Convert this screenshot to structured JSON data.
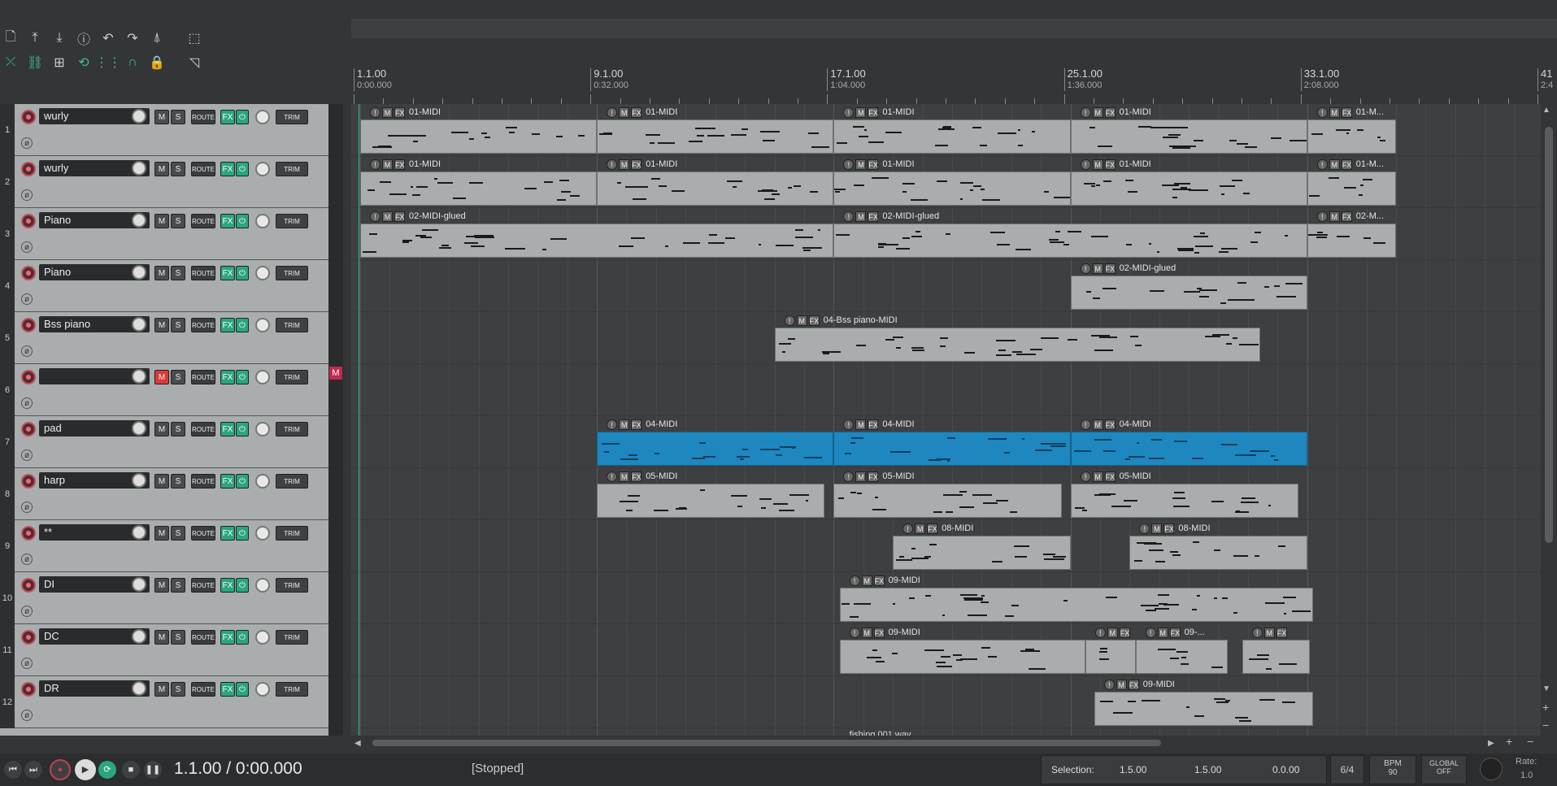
{
  "toolbar": {
    "row1": [
      "new-project-icon",
      "open-project-icon",
      "save-project-icon",
      "info-icon",
      "undo-icon",
      "redo-icon",
      "metronome-icon",
      "grid-toggle-icon"
    ],
    "row2": [
      "ripple-icon",
      "link-icon",
      "grid-snap-icon",
      "loop-link-icon",
      "snap-grid-icon",
      "magnet-icon",
      "lock-icon",
      "envelope-tool-icon"
    ]
  },
  "ruler": [
    {
      "bar": "1.1.00",
      "time": "0:00.000"
    },
    {
      "bar": "9.1.00",
      "time": "0:32.000"
    },
    {
      "bar": "17.1.00",
      "time": "1:04.000"
    },
    {
      "bar": "25.1.00",
      "time": "1:36.000"
    },
    {
      "bar": "33.1.00",
      "time": "2:08.000"
    },
    {
      "bar": "41",
      "time": "2:4"
    }
  ],
  "tcp": {
    "mute_label": "M",
    "solo_label": "S",
    "route_label": "ROUTE",
    "fx_label": "FX",
    "power_label": "⏻",
    "trim_label": "TRIM",
    "phase_label": "ø"
  },
  "tracks": [
    {
      "num": "1",
      "name": "wurly",
      "muted": false
    },
    {
      "num": "2",
      "name": "wurly",
      "muted": false
    },
    {
      "num": "3",
      "name": "Piano",
      "muted": false
    },
    {
      "num": "4",
      "name": "Piano",
      "muted": false
    },
    {
      "num": "5",
      "name": "Bss piano",
      "muted": false
    },
    {
      "num": "6",
      "name": "",
      "muted": true
    },
    {
      "num": "7",
      "name": "pad",
      "muted": false
    },
    {
      "num": "8",
      "name": "harp",
      "muted": false
    },
    {
      "num": "9",
      "name": "**",
      "muted": false
    },
    {
      "num": "10",
      "name": "DI",
      "muted": false
    },
    {
      "num": "11",
      "name": "DC",
      "muted": false
    },
    {
      "num": "12",
      "name": "DR",
      "muted": false
    }
  ],
  "meter_mute_label": "M",
  "items": [
    {
      "track": 0,
      "start": 0,
      "end": 8,
      "label": "01-MIDI"
    },
    {
      "track": 0,
      "start": 8,
      "end": 16,
      "label": "01-MIDI"
    },
    {
      "track": 0,
      "start": 16,
      "end": 24,
      "label": "01-MIDI"
    },
    {
      "track": 0,
      "start": 24,
      "end": 32,
      "label": "01-MIDI"
    },
    {
      "track": 0,
      "start": 32,
      "end": 35,
      "label": "01-M..."
    },
    {
      "track": 1,
      "start": 0,
      "end": 8,
      "label": "01-MIDI"
    },
    {
      "track": 1,
      "start": 8,
      "end": 16,
      "label": "01-MIDI"
    },
    {
      "track": 1,
      "start": 16,
      "end": 24,
      "label": "01-MIDI"
    },
    {
      "track": 1,
      "start": 24,
      "end": 32,
      "label": "01-MIDI"
    },
    {
      "track": 1,
      "start": 32,
      "end": 35,
      "label": "01-M..."
    },
    {
      "track": 2,
      "start": 0,
      "end": 16,
      "label": "02-MIDI-glued"
    },
    {
      "track": 2,
      "start": 16,
      "end": 32,
      "label": "02-MIDI-glued"
    },
    {
      "track": 2,
      "start": 32,
      "end": 35,
      "label": "02-M..."
    },
    {
      "track": 3,
      "start": 24,
      "end": 32,
      "label": "02-MIDI-glued"
    },
    {
      "track": 4,
      "start": 14,
      "end": 30.4,
      "label": "04-Bss piano-MIDI"
    },
    {
      "track": 6,
      "start": 8,
      "end": 16,
      "label": "04-MIDI",
      "selected": true
    },
    {
      "track": 6,
      "start": 16,
      "end": 24,
      "label": "04-MIDI",
      "selected": true
    },
    {
      "track": 6,
      "start": 24,
      "end": 32,
      "label": "04-MIDI",
      "selected": true
    },
    {
      "track": 7,
      "start": 8,
      "end": 15.7,
      "label": "05-MIDI"
    },
    {
      "track": 7,
      "start": 16,
      "end": 23.7,
      "label": "05-MIDI"
    },
    {
      "track": 7,
      "start": 24,
      "end": 31.7,
      "label": "05-MIDI"
    },
    {
      "track": 8,
      "start": 18,
      "end": 24,
      "label": "08-MIDI"
    },
    {
      "track": 8,
      "start": 26,
      "end": 32,
      "label": "08-MIDI"
    },
    {
      "track": 9,
      "start": 16.2,
      "end": 32.2,
      "label": "09-MIDI"
    },
    {
      "track": 10,
      "start": 16.2,
      "end": 24.5,
      "label": "09-MIDI"
    },
    {
      "track": 10,
      "start": 24.5,
      "end": 26.2,
      "label": ""
    },
    {
      "track": 10,
      "start": 26.2,
      "end": 29.3,
      "label": "09-..."
    },
    {
      "track": 10,
      "start": 29.8,
      "end": 32.1,
      "label": ""
    },
    {
      "track": 11,
      "start": 24.8,
      "end": 32.2,
      "label": "09-MIDI"
    }
  ],
  "partial_item_label": "fishing 001.wav",
  "transport": {
    "time": "1.1.00 / 0:00.000",
    "status": "[Stopped]",
    "selection_label": "Selection:",
    "sel_start": "1.5.00",
    "sel_end": "1.5.00",
    "sel_len": "0.0.00",
    "timesig": "6/4",
    "bpm_label": "BPM",
    "bpm": "90",
    "global_label": "GLOBAL",
    "global_state": "OFF",
    "rate_label": "Rate:",
    "rate": "1.0"
  },
  "colors": {
    "item": "#a9adad",
    "selected_item": "#1e87c0",
    "accent": "#2aa580",
    "mute_on": "#d93a3a"
  }
}
